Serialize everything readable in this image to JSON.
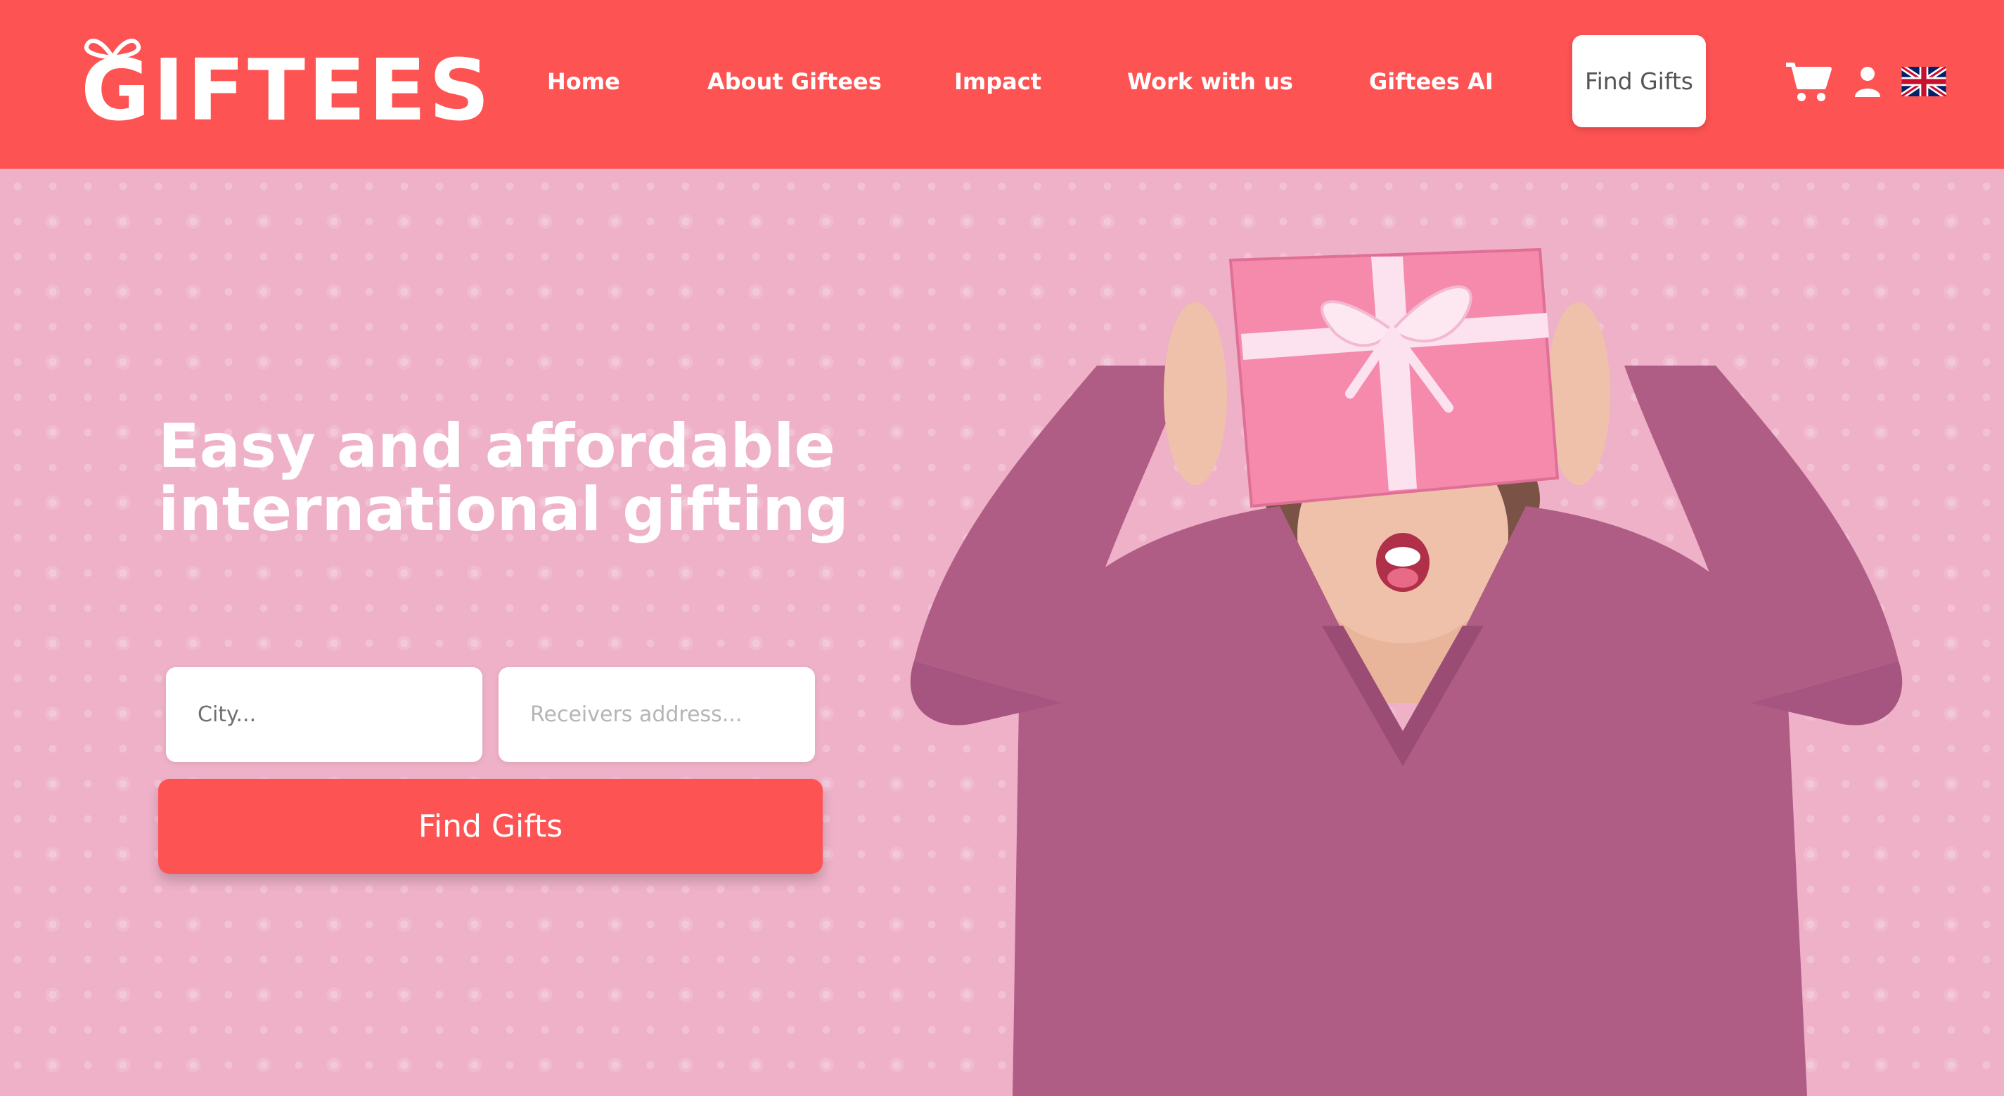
{
  "header": {
    "logo_text": "GIFTEES",
    "nav": [
      {
        "label": "Home"
      },
      {
        "label": "About Giftees"
      },
      {
        "label": "Impact"
      },
      {
        "label": "Work with us"
      },
      {
        "label": "Giftees AI"
      }
    ],
    "cta_label": "Find Gifts",
    "icons": [
      "cart-icon",
      "user-icon",
      "uk-flag-icon"
    ]
  },
  "hero": {
    "headline_line1": "Easy and affordable",
    "headline_line2": "international gifting",
    "city_placeholder": "City...",
    "address_placeholder": "Receivers address...",
    "button_label": "Find Gifts"
  },
  "colors": {
    "brand_red": "#fd5353",
    "hero_pink": "#eeb1c8",
    "sweater": "#b05d86",
    "gift_box": "#f58aad"
  }
}
